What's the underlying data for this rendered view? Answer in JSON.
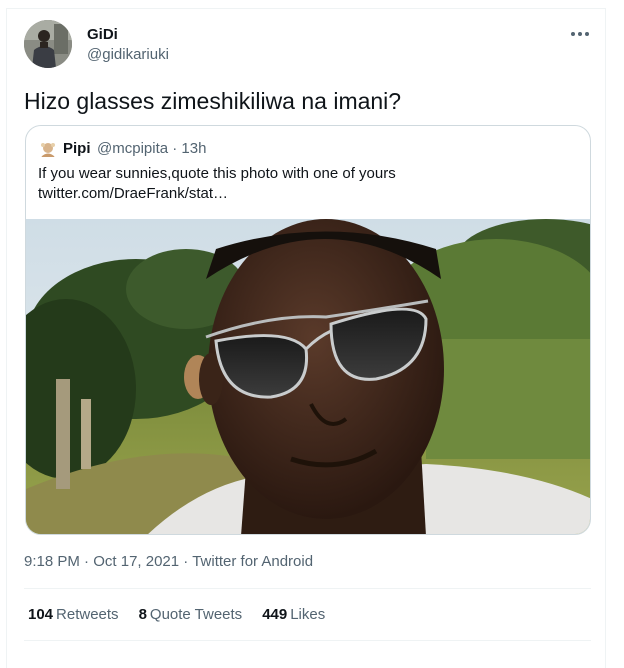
{
  "tweet": {
    "author": {
      "display_name": "GiDi",
      "handle": "@gidikariuki"
    },
    "more_icon": "more-horizontal-icon",
    "text": "Hizo glasses zimeshikiliwa na imani?",
    "quoted": {
      "author": "Pipi",
      "handle_time": "@mcpipita · 13h",
      "text_line1": "If you wear sunnies,quote this photo with one of yours",
      "text_line2": "twitter.com/DraeFrank/stat…",
      "photo_description_icon": "selfie-photo"
    },
    "meta": {
      "time": "9:18 PM",
      "sep1": " · ",
      "date": "Oct 17, 2021",
      "sep2": " · ",
      "source": "Twitter for Android"
    },
    "stats": {
      "retweets_count": "104",
      "retweets_label": "Retweets",
      "quotes_count": "8",
      "quotes_label": "Quote Tweets",
      "likes_count": "449",
      "likes_label": "Likes"
    }
  },
  "colors": {
    "text_primary": "#0f1419",
    "text_secondary": "#536471",
    "border": "#cfd9de",
    "divider": "#eff3f4"
  }
}
